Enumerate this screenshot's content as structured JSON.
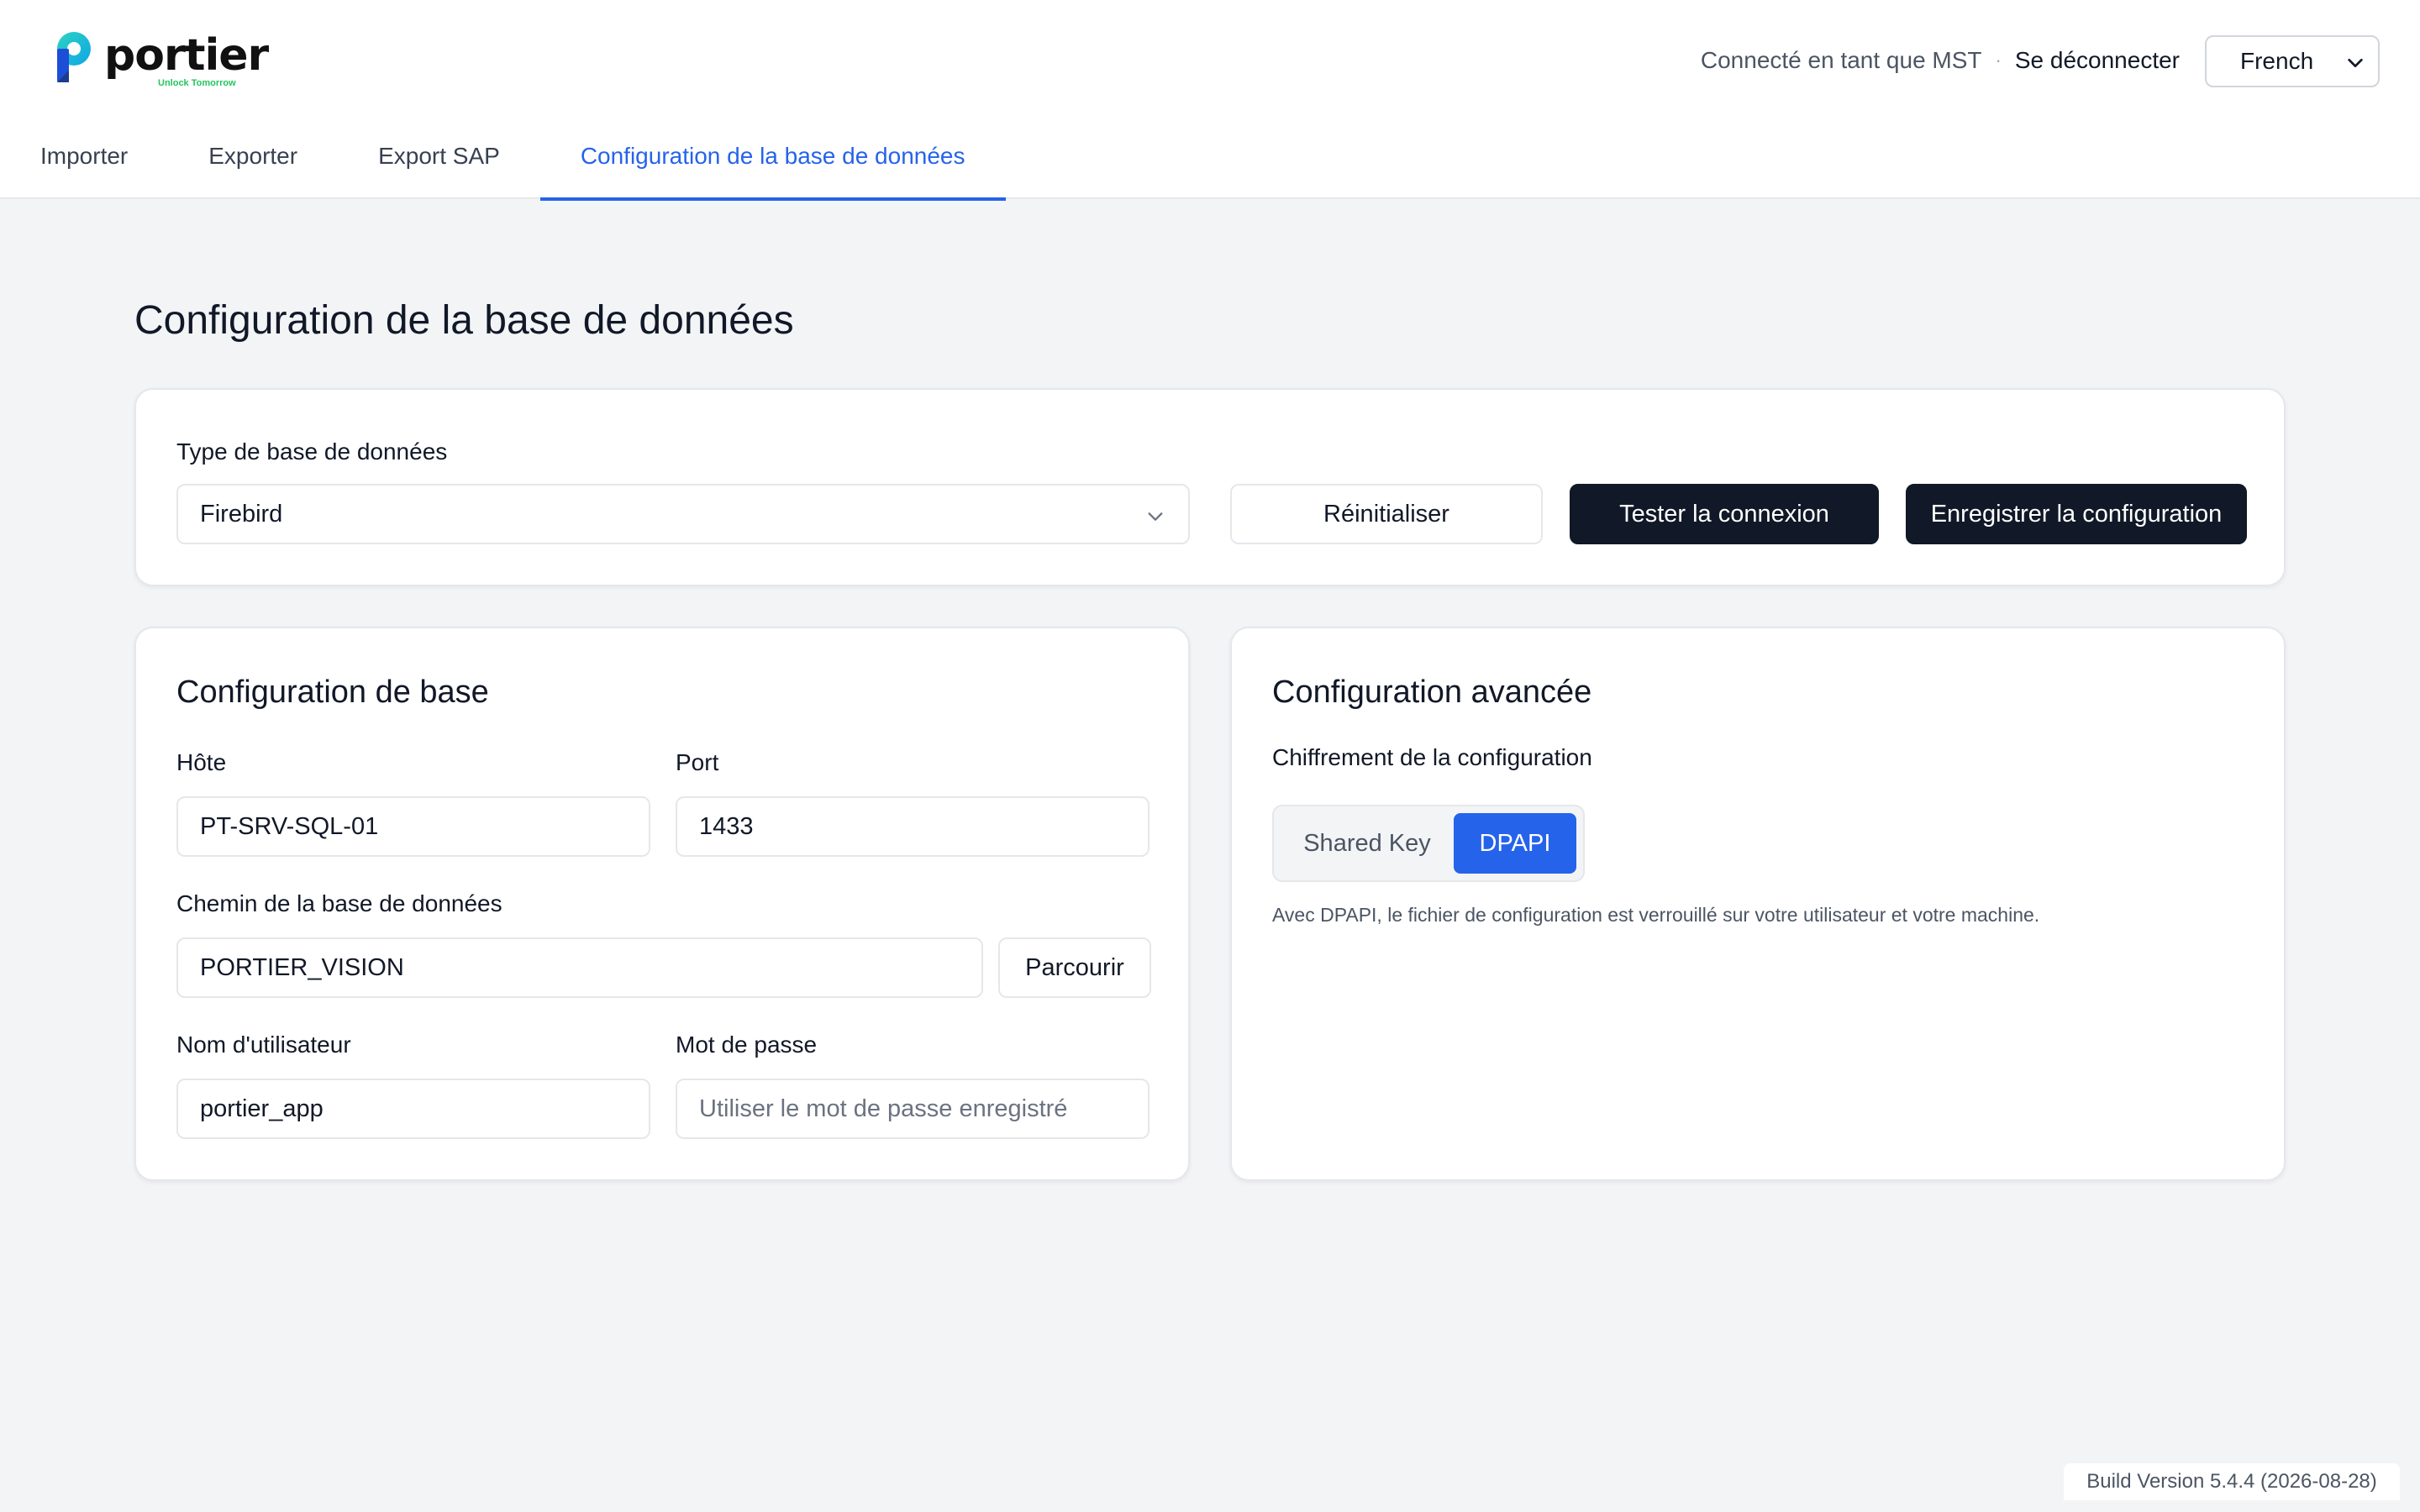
{
  "header": {
    "logo_text": "portier",
    "logo_tagline": "Unlock Tomorrow",
    "connected_as": "Connecté en tant que MST",
    "separator": "·",
    "logout_label": "Se déconnecter",
    "language_selected": "French"
  },
  "tabs": [
    {
      "label": "Importer",
      "active": false
    },
    {
      "label": "Exporter",
      "active": false
    },
    {
      "label": "Export SAP",
      "active": false
    },
    {
      "label": "Configuration de la base de données",
      "active": true
    }
  ],
  "page": {
    "title": "Configuration de la base de données"
  },
  "db_type_card": {
    "label": "Type de base de données",
    "selected_value": "Firebird",
    "reset_label": "Réinitialiser",
    "test_label": "Tester la connexion",
    "save_label": "Enregistrer la configuration"
  },
  "base_config": {
    "heading": "Configuration de base",
    "host_label": "Hôte",
    "host_value": "PT-SRV-SQL-01",
    "port_label": "Port",
    "port_value": "1433",
    "path_label": "Chemin de la base de données",
    "path_value": "PORTIER_VISION",
    "browse_label": "Parcourir",
    "username_label": "Nom d'utilisateur",
    "username_value": "portier_app",
    "password_label": "Mot de passe",
    "password_placeholder": "Utiliser le mot de passe enregistré"
  },
  "advanced_config": {
    "heading": "Configuration avancée",
    "encryption_label": "Chiffrement de la configuration",
    "options": [
      {
        "label": "Shared Key",
        "selected": false
      },
      {
        "label": "DPAPI",
        "selected": true
      }
    ],
    "hint": "Avec DPAPI, le fichier de configuration est verrouillé sur votre utilisateur et votre machine."
  },
  "footer": {
    "build_version": "Build Version 5.4.4 (2026-08-28)"
  },
  "colors": {
    "accent": "#2563eb",
    "dark_button": "#111827",
    "background": "#f3f4f6",
    "logo_blue": "#2563eb",
    "logo_teal": "#14b8a6",
    "logo_green": "#22c55e"
  }
}
